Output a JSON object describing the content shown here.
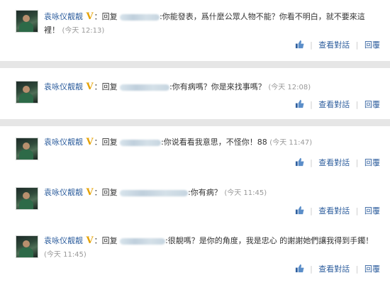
{
  "colors": {
    "link": "#2f5f9e",
    "text": "#333333",
    "time": "#999999",
    "vip": "#e5a100",
    "separator_band": "#e6e6e6"
  },
  "icons": {
    "verified": "V",
    "like": "thumbs-up-icon"
  },
  "actions": {
    "view_conversation": "查看對話",
    "reply": "回覆",
    "separator": "|"
  },
  "comments": [
    {
      "username": "袁咏仪靓靓",
      "colon": "：",
      "reply_prefix": "回复",
      "message": ":你能發表，爲什麼公眾人物不能？你看不明白，就不要來這裡！",
      "time": "(今天 12:13)"
    },
    {
      "username": "袁咏仪靓靓",
      "colon": "：",
      "reply_prefix": "回复",
      "message": ":你有病嗎？你是來找事嗎？",
      "time": "(今天 12:08)"
    },
    {
      "username": "袁咏仪靓靓",
      "colon": "：",
      "reply_prefix": "回复",
      "message": ":你说看看我意思，不怪你！88",
      "time": "(今天 11:47)"
    },
    {
      "username": "袁咏仪靓靓",
      "colon": "：",
      "reply_prefix": "回复",
      "message": ":你有病？",
      "time": "(今天 11:45)"
    },
    {
      "username": "袁咏仪靓靓",
      "colon": "：",
      "reply_prefix": "回复",
      "message": ":很靚嗎？是你的角度，我是忠心 的謝謝她們讓我得到手鐲！",
      "time": "(今天 11:45)"
    }
  ]
}
